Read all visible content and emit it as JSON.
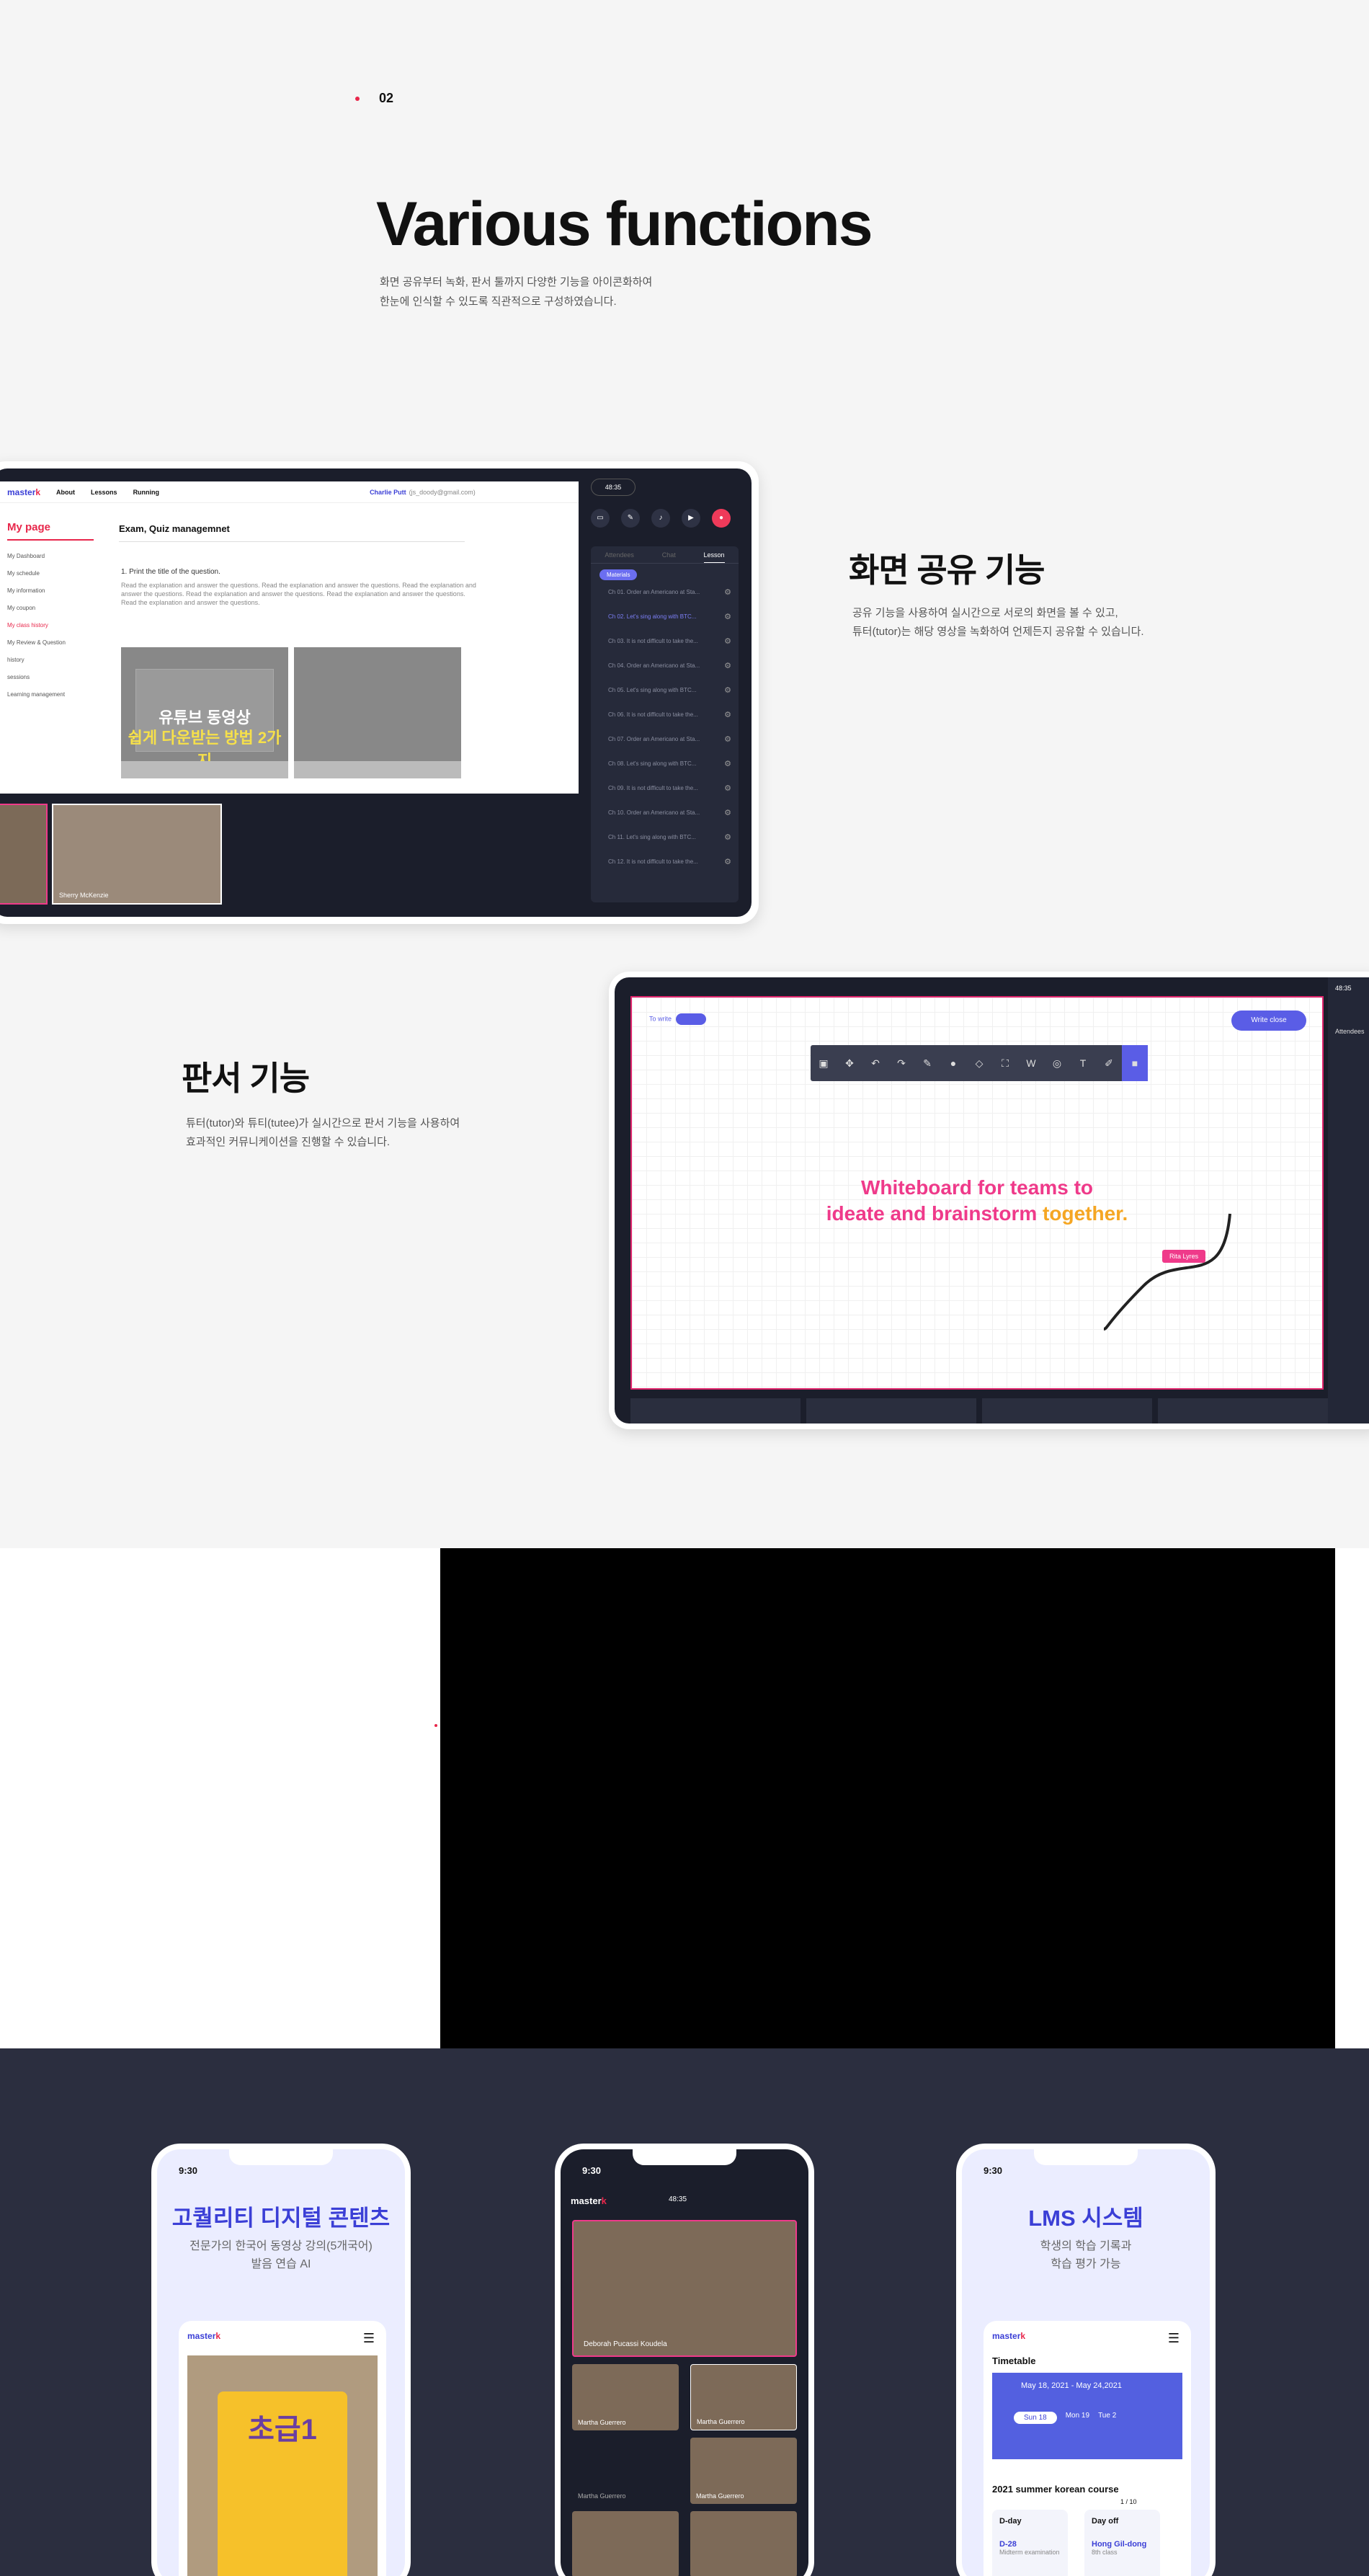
{
  "section": {
    "number": "02",
    "title": "Various functions",
    "desc_line1": "화면 공유부터 녹화, 판서 툴까지 다양한 기능을 아이콘화하여",
    "desc_line2": "한눈에 인식할 수 있도록 직관적으로 구성하였습니다."
  },
  "feature1": {
    "title": "화면 공유 기능",
    "desc_line1": "공유 기능을 사용하여 실시간으로 서로의 화면을 볼 수 있고,",
    "desc_line2": "튜터(tutor)는 해당 영상을 녹화하여 언제든지 공유할 수 있습니다."
  },
  "feature2": {
    "title": "판서 기능",
    "desc_line1": "튜터(tutor)와 튜티(tutee)가 실시간으로 판서 기능을 사용하여",
    "desc_line2": "효과적인 커뮤니케이션을 진행할 수 있습니다."
  },
  "screen1": {
    "logo": "master",
    "nav": [
      "About",
      "Lessons",
      "Running"
    ],
    "user": "Charlie Putt",
    "email": "(js_doody@gmail.com)",
    "sidebar_title": "My page",
    "sidebar": [
      "My Dashboard",
      "My schedule",
      "My information",
      "My coupon",
      "My class history",
      "My Review & Question",
      "history",
      "sessions",
      "Learning management"
    ],
    "heading": "Exam, Quiz managemnet",
    "question": "1. Print the title of the question.",
    "question_desc": "Read the explanation and answer the questions. Read the explanation and answer the questions. Read the explanation and answer the questions. Read the explanation and answer the questions. Read the explanation and answer the questions. Read the explanation and answer the questions.",
    "video_title1": "유튜브 동영상",
    "video_title2": "쉽게 다운받는 방법 2가지",
    "participant": "Sherry McKenzie",
    "timer": "48:35",
    "tabs": [
      "Attendees",
      "Chat",
      "Lesson"
    ],
    "materials": "Materials",
    "lessons": [
      "Ch 01. Order an Americano at Sta...",
      "Ch 02. Let's sing along with BTC...",
      "Ch 03. It is not difficult to take the...",
      "Ch 04. Order an Americano at Sta...",
      "Ch 05. Let's sing along with BTC...",
      "Ch 06. It is not difficult to take the...",
      "Ch 07. Order an Americano at Sta...",
      "Ch 08. Let's sing along with BTC...",
      "Ch 09. It is not difficult to take the...",
      "Ch 10. Order an Americano at Sta...",
      "Ch 11. Let's sing along with BTC...",
      "Ch 12. It is not difficult to take the..."
    ]
  },
  "screen2": {
    "toggle_label": "To write",
    "toggle_state": "ON",
    "close_button": "Write close",
    "tool_icons": [
      "▣",
      "✥",
      "↶",
      "↷",
      "✎",
      "●",
      "◇",
      "⛶",
      "W",
      "◎",
      "T",
      "✐",
      "■"
    ],
    "headline1": "Whiteboard for teams to",
    "headline2a": "ideate and brainstorm",
    "headline2b": "together.",
    "tag": "Rita Lyres",
    "timer": "48:35",
    "attendees": "Attendees"
  },
  "phones": [
    {
      "time": "9:30",
      "title": "고퀄리티 디지털 콘텐츠",
      "sub1": "전문가의 한국어 동영상 강의(5개국어)",
      "sub2": "발음 연습 AI",
      "logo": "master",
      "book": "초급1"
    },
    {
      "time": "9:30",
      "logo": "master",
      "timer": "48:35",
      "names": [
        "Deborah Pucassi Koudela",
        "Martha Guerrero",
        "Martha Guerrero",
        "Martha Guerrero",
        "Martha Guerrero"
      ]
    },
    {
      "time": "9:30",
      "title": "LMS 시스템",
      "sub1": "학생의 학습 기록과",
      "sub2": "학습 평가 가능",
      "logo": "master",
      "timetable": "Timetable",
      "range": "May 18, 2021 - May 24,2021",
      "days": [
        "Sun 18",
        "Mon 19",
        "Tue 2"
      ],
      "course": "2021 summer korean course",
      "dday": "D-day",
      "dday_val": "D-28",
      "dday_sub": "Midterm examination",
      "dayoff": "Day off",
      "dayoff_name": "Hong Gil-dong",
      "dayoff_sub": "8th class",
      "page": "1 / 10"
    }
  ],
  "colors": {
    "brand": "#3b3fd6",
    "accent": "#e8274b",
    "pink": "#ef3a8a",
    "orange": "#f5a623",
    "dark": "#2b2e3f"
  }
}
